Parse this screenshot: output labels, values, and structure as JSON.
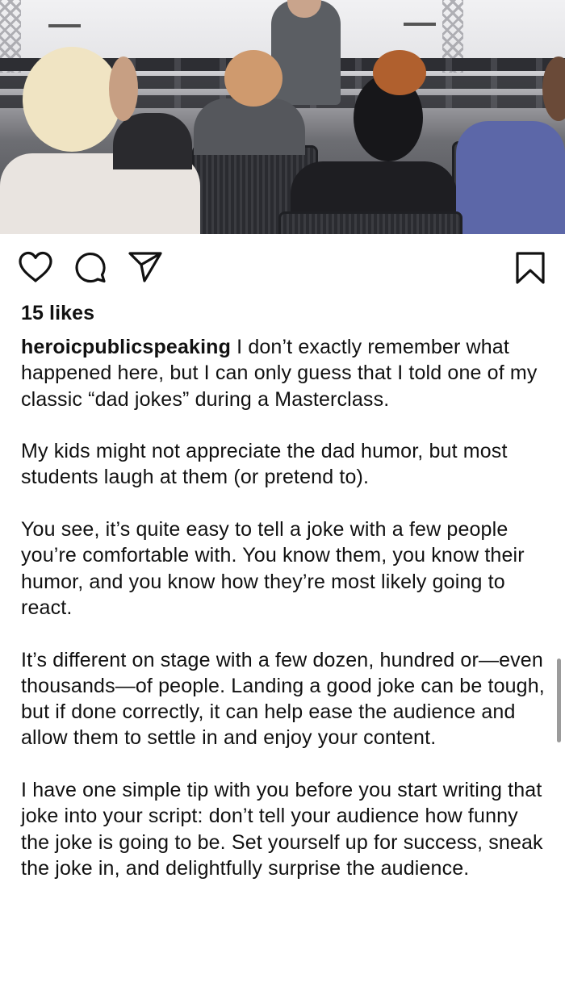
{
  "post": {
    "image_alt_icon": "photo-of-masterclass-audience",
    "likes_text": "15 likes",
    "username": "heroicpublicspeaking",
    "caption_paragraphs": [
      "I don’t exactly remember what happened here, but I can only guess that I told one of my classic “dad jokes” during a Masterclass.",
      "My kids might not appreciate the dad humor, but most students laugh at them (or pretend to).",
      "You see, it’s quite easy to tell a joke with a few people you’re comfortable with. You know them, you know their humor, and you know how they’re most likely going to react.",
      "It’s different on stage with a few dozen, hundred or—even thousands—of people. Landing a good joke can be tough, but if done correctly, it can help ease the audience and allow them to settle in and enjoy your content.",
      "I have one simple tip with you before you start writing that joke into your script: don’t tell your audience how funny the joke is going to be. Set yourself up for success, sneak the joke in, and delightfully surprise the audience."
    ]
  },
  "actions": {
    "like_icon": "heart-icon",
    "comment_icon": "comment-icon",
    "share_icon": "send-icon",
    "save_icon": "bookmark-icon"
  },
  "colors": {
    "text": "#111111",
    "background": "#ffffff"
  }
}
